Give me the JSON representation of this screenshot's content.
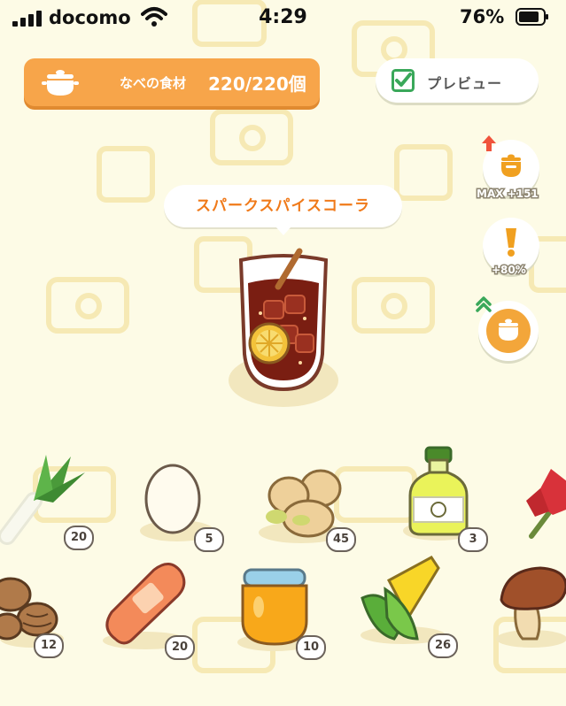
{
  "status_bar": {
    "carrier": "docomo",
    "time": "4:29",
    "battery_percent": "76%"
  },
  "ingredients_bar": {
    "label": "なべの食材",
    "count": "220/220個"
  },
  "preview_button": {
    "label": "プレビュー"
  },
  "side_buttons": {
    "pot_capacity_label": "MAX +151",
    "bonus_label": "+80%"
  },
  "dish": {
    "name": "スパークスパイスコーラ"
  },
  "ingredients": [
    {
      "icon": "leek-icon",
      "count": "20"
    },
    {
      "icon": "egg-icon",
      "count": "5"
    },
    {
      "icon": "potato-icon",
      "count": "45"
    },
    {
      "icon": "oil-bottle-icon",
      "count": "3"
    },
    {
      "icon": "herb-icon",
      "count": ""
    },
    {
      "icon": "cacao-icon",
      "count": "12"
    },
    {
      "icon": "sausage-icon",
      "count": "20"
    },
    {
      "icon": "honey-jar-icon",
      "count": "10"
    },
    {
      "icon": "corn-icon",
      "count": "26"
    },
    {
      "icon": "mushroom-icon",
      "count": ""
    }
  ],
  "colors": {
    "background": "#fdfbe6",
    "accent_orange": "#f7a54a",
    "dish_name_text": "#f07a1a",
    "check_green": "#3aa85a"
  }
}
